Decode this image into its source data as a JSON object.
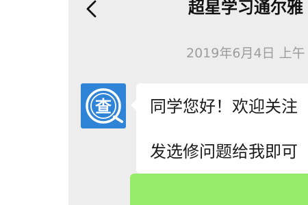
{
  "header": {
    "title": "超星学习通尔雅",
    "back_icon": "chevron-left-icon"
  },
  "chat": {
    "timestamp": "2019年6月4日 上午",
    "messages": [
      {
        "sender_avatar_icon": "cha-logo-icon",
        "sender_avatar_glyph": "查",
        "avatar_color": "#2f84d8",
        "lines": [
          "同学您好！欢迎关注",
          "发选修问题给我即可"
        ]
      }
    ],
    "outgoing_bubble_color": "#95ec69"
  },
  "colors": {
    "panel_bg": "#ededed",
    "timestamp_text": "#9c9c9c"
  }
}
